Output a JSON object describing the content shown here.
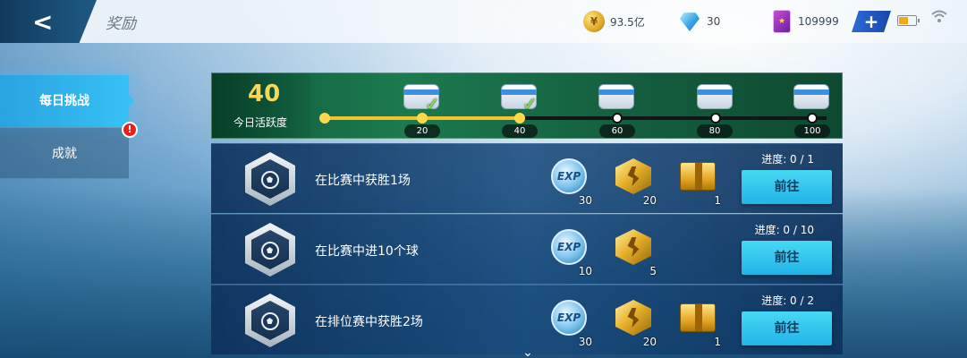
{
  "header": {
    "back_glyph": "<",
    "title": "奖励"
  },
  "resources": {
    "coins": "93.5亿",
    "diamonds": "30",
    "cards": "109999",
    "coin_icon": "coin-icon",
    "diamond_icon": "diamond-icon",
    "card_icon": "card-icon",
    "plus_label": "+"
  },
  "status": {
    "battery_level": 0.55,
    "battery_color": "#f2a916"
  },
  "sidebar": {
    "items": [
      {
        "label": "每日挑战",
        "active": true
      },
      {
        "label": "成就",
        "active": false,
        "alert": "!"
      }
    ]
  },
  "activity": {
    "value": "40",
    "label": "今日活跃度",
    "progress_fraction": 0.4,
    "milestones": [
      {
        "label": "20",
        "claimed": true
      },
      {
        "label": "40",
        "claimed": true
      },
      {
        "label": "60",
        "claimed": false
      },
      {
        "label": "80",
        "claimed": false
      },
      {
        "label": "100",
        "claimed": false
      }
    ]
  },
  "tasks": [
    {
      "name": "在比赛中获胜1场",
      "progress": "进度: 0 / 1",
      "button": "前往",
      "rewards": [
        {
          "icon": "exp-icon",
          "label": "EXP",
          "qty": "30"
        },
        {
          "icon": "medal-icon",
          "qty": "20"
        },
        {
          "icon": "box-icon",
          "qty": "1"
        }
      ]
    },
    {
      "name": "在比赛中进10个球",
      "progress": "进度: 0 / 10",
      "button": "前往",
      "rewards": [
        {
          "icon": "exp-icon",
          "label": "EXP",
          "qty": "10"
        },
        {
          "icon": "medal-icon",
          "qty": "5"
        }
      ]
    },
    {
      "name": "在排位赛中获胜2场",
      "progress": "进度: 0 / 2",
      "button": "前往",
      "rewards": [
        {
          "icon": "exp-icon",
          "label": "EXP",
          "qty": "30"
        },
        {
          "icon": "medal-icon",
          "qty": "20"
        },
        {
          "icon": "box-icon",
          "qty": "1"
        }
      ]
    }
  ],
  "theme": {
    "accent": "#37c1f4",
    "activity_bar": "#f1c232",
    "row_bg": "#184b7d"
  }
}
